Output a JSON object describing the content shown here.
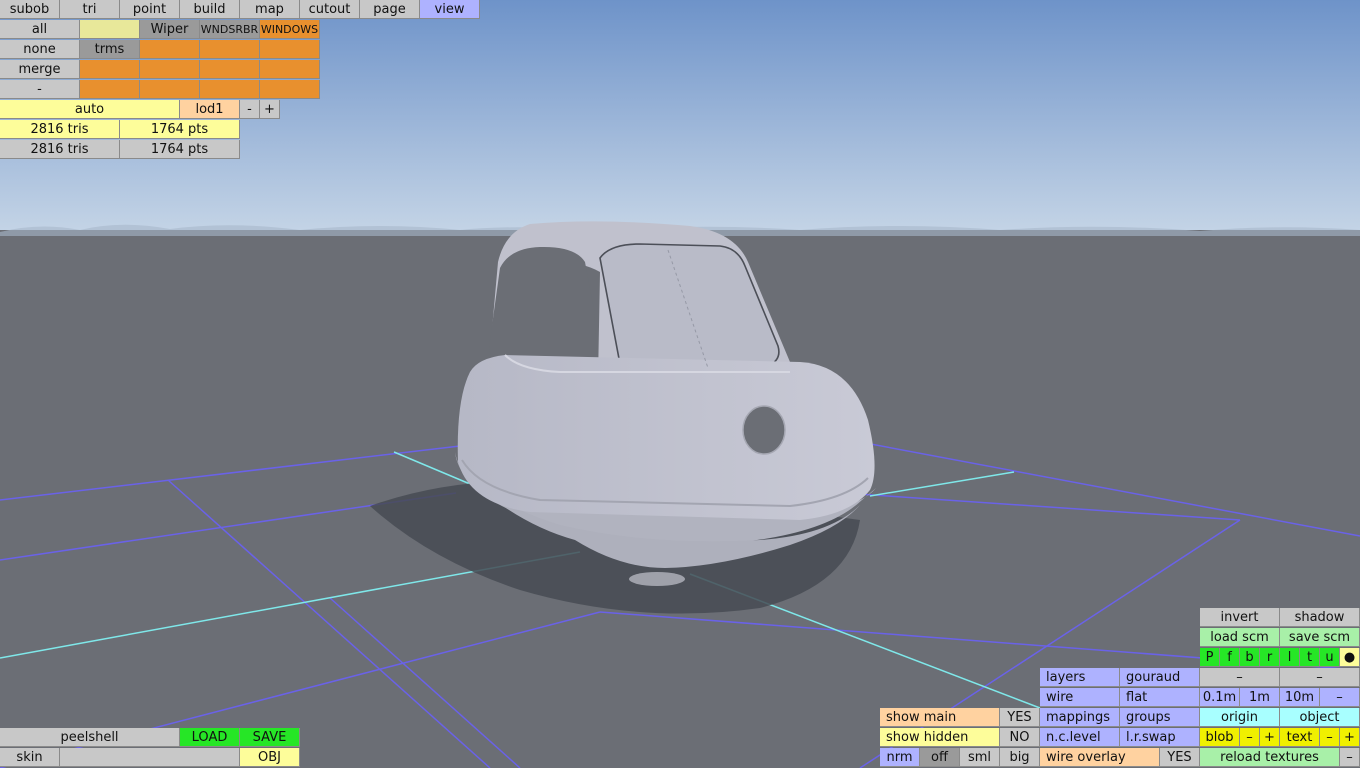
{
  "top_menu": [
    "subob",
    "tri",
    "point",
    "build",
    "map",
    "cutout",
    "page",
    "view"
  ],
  "selection": {
    "all": "all",
    "none": "none",
    "merge": "merge",
    "minus": "-",
    "wiper": "Wiper",
    "wndsrbr": "WNDSRBR",
    "windows": "WINDOWS",
    "trms": "trms"
  },
  "lod": {
    "auto": "auto",
    "lod": "lod1",
    "minus": "-",
    "plus": "+"
  },
  "stats": [
    {
      "tris": "2816 tris",
      "pts": "1764 pts"
    },
    {
      "tris": "2816 tris",
      "pts": "1764 pts"
    }
  ],
  "bottom_left": {
    "peelshell": "peelshell",
    "load": "LOAD",
    "save": "SAVE",
    "skin": "skin",
    "obj": "OBJ"
  },
  "display": {
    "show_main": "show main",
    "show_main_val": "YES",
    "show_hidden": "show hidden",
    "show_hidden_val": "NO",
    "nrm": "nrm",
    "off": "off",
    "sml": "sml",
    "big": "big",
    "layers": "layers",
    "gouraud": "gouraud",
    "wire": "wire",
    "flat": "flat",
    "mappings": "mappings",
    "groups": "groups",
    "nc_level": "n.c.level",
    "lr_swap": "l.r.swap",
    "wire_overlay": "wire overlay",
    "wire_overlay_val": "YES"
  },
  "right_panel": {
    "invert": "invert",
    "shadow": "shadow",
    "load_scm": "load scm",
    "save_scm": "save scm",
    "views": [
      "P",
      "f",
      "b",
      "r",
      "l",
      "t",
      "u",
      "●"
    ],
    "dash1": "–",
    "dash2": "–",
    "g01": "0.1m",
    "g1": "1m",
    "g10": "10m",
    "gminus": "–",
    "origin": "origin",
    "object": "object",
    "blob": "blob",
    "blob_minus": "–",
    "blob_plus": "+",
    "text": "text",
    "text_minus": "–",
    "text_plus": "+",
    "reload": "reload textures",
    "reload_minus": "–"
  },
  "colors": {
    "sky_top": "#6e93c9",
    "sky_bottom": "#bcd0e6",
    "ground": "#6b6e75",
    "model": "#c3c4d0",
    "grid": "#6a62e8",
    "axis": "#7fe8ea"
  }
}
